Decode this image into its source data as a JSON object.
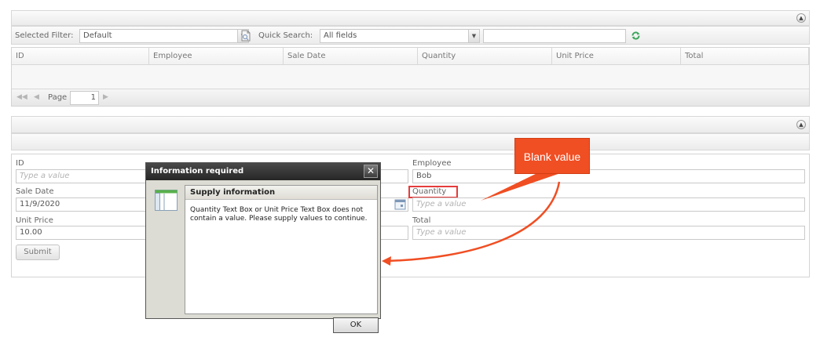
{
  "grid_panel": {
    "filter_label": "Selected Filter:",
    "filter_value": "Default",
    "quick_search_label": "Quick Search:",
    "quick_search_field": "All fields",
    "quick_search_text": "",
    "columns": [
      "ID",
      "Employee",
      "Sale Date",
      "Quantity",
      "Unit Price",
      "Total"
    ],
    "pager": {
      "page_label": "Page",
      "page_number": "1"
    }
  },
  "form_panel": {
    "id_label": "ID",
    "id_placeholder": "Type a value",
    "employee_label": "Employee",
    "employee_value": "Bob",
    "sale_date_label": "Sale Date",
    "sale_date_value": "11/9/2020",
    "quantity_label": "Quantity",
    "quantity_placeholder": "Type a value",
    "unit_price_label": "Unit Price",
    "unit_price_value": "10.00",
    "total_label": "Total",
    "total_placeholder": "Type a value",
    "submit_label": "Submit"
  },
  "dialog": {
    "title": "Information required",
    "close_glyph": "✕",
    "heading": "Supply information",
    "message": "Quantity Text Box or Unit Price Text Box does not contain a value. Please supply values to continue.",
    "ok_label": "OK"
  },
  "callout": {
    "text": "Blank value"
  },
  "colors": {
    "callout": "#f04e23",
    "highlight_box": "#e53b3b",
    "dialog_title": "#2e2e2e"
  },
  "icons": [
    "collapse-icon",
    "dropdown-arrow-icon",
    "filter-doc-icon",
    "refresh-icon",
    "first-page-icon",
    "prev-page-icon",
    "next-page-icon",
    "calendar-icon",
    "close-icon",
    "info-window-icon"
  ]
}
